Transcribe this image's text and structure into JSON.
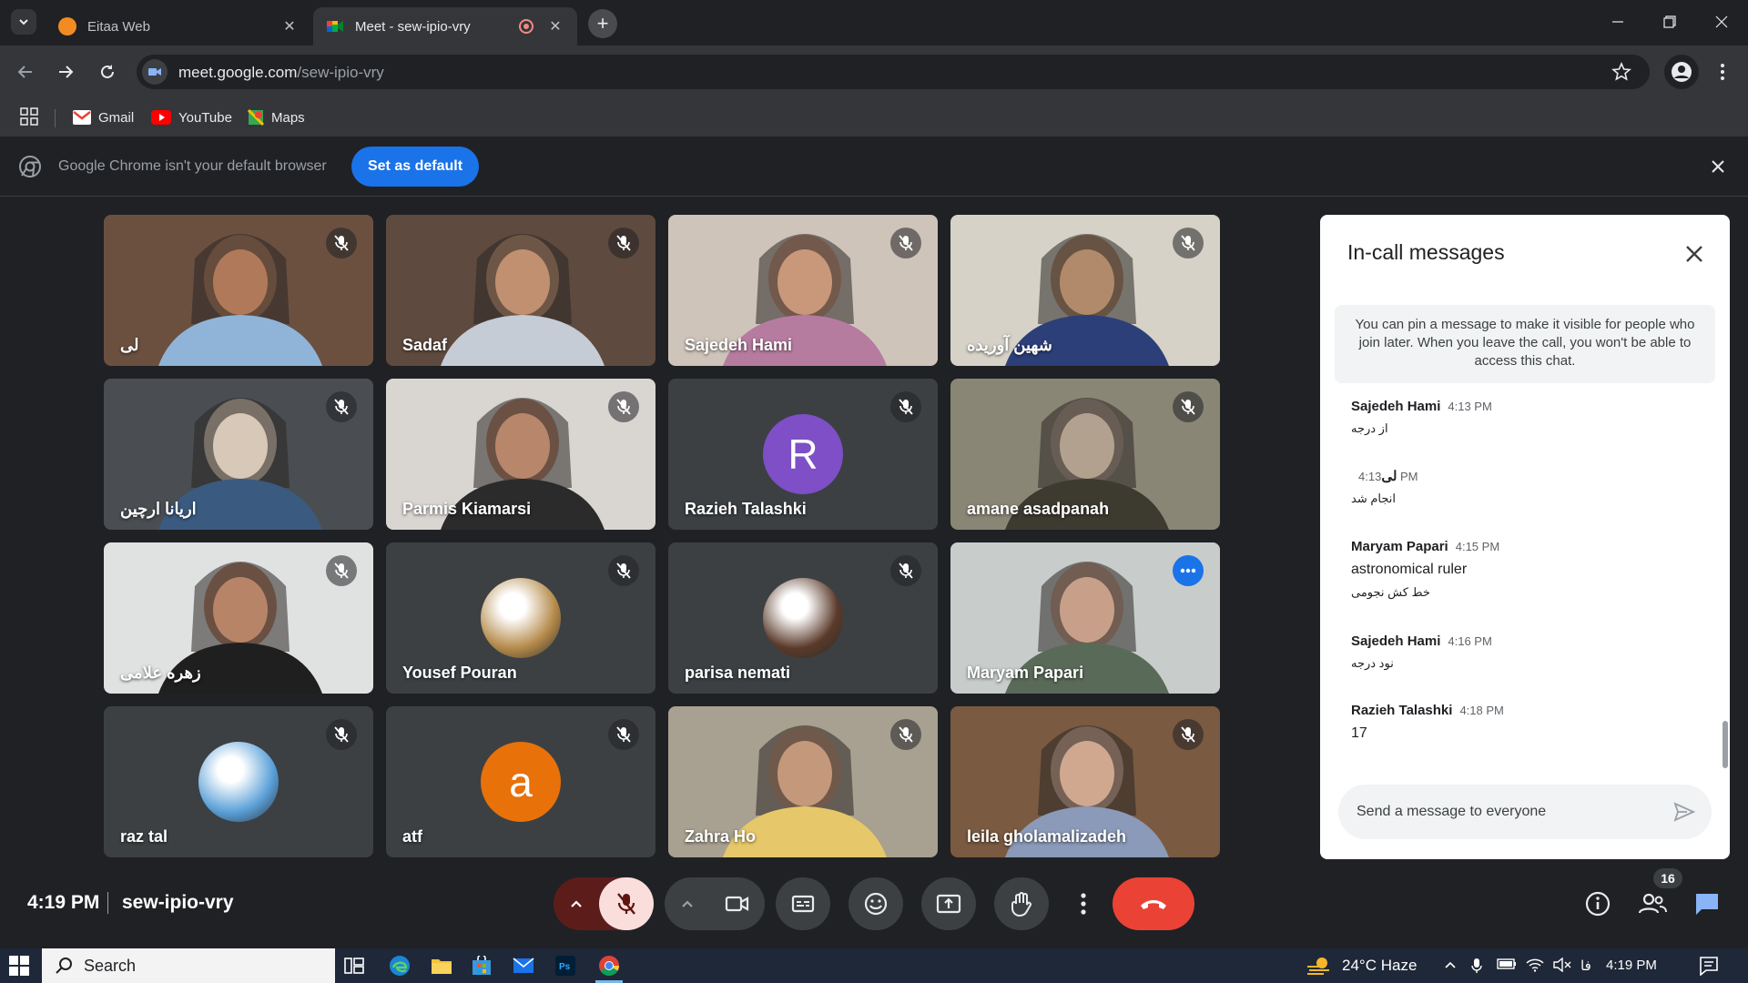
{
  "browser": {
    "tabs": [
      {
        "title": "Eitaa Web",
        "active": false
      },
      {
        "title": "Meet - sew-ipio-vry",
        "active": true
      }
    ],
    "url_host": "meet.google.com",
    "url_path": "/sew-ipio-vry",
    "bookmarks": [
      "Gmail",
      "YouTube",
      "Maps"
    ],
    "infobar": {
      "message": "Google Chrome isn't your default browser",
      "button": "Set as default"
    }
  },
  "participants": [
    {
      "name": "لی",
      "type": "video",
      "bg": "#6b5040",
      "skin": "#b07a5a",
      "cloth": "#8fb4d8"
    },
    {
      "name": "Sadaf",
      "type": "video",
      "bg": "#5e4a3e",
      "skin": "#c09070",
      "cloth": "#c6ccd6"
    },
    {
      "name": "Sajedeh Hami",
      "type": "video",
      "bg": "#cfc4ba",
      "skin": "#c9987a",
      "cloth": "#b67ca0"
    },
    {
      "name": "شهین آوریده",
      "type": "video",
      "bg": "#d6d2c8",
      "skin": "#b08a6a",
      "cloth": "#2c3f78"
    },
    {
      "name": "اریانا ارچین",
      "type": "video",
      "bg": "#4a4e52",
      "skin": "#d8c8b8",
      "cloth": "#3a5a80"
    },
    {
      "name": "Parmis Kiamarsi",
      "type": "video",
      "bg": "#d9d6d2",
      "skin": "#b8866a",
      "cloth": "#2b2b2b"
    },
    {
      "name": "Razieh Talashki",
      "type": "letter",
      "letter": "R",
      "color": "#7e4fc7"
    },
    {
      "name": "amane asadpanah",
      "type": "video",
      "bg": "#8a8676",
      "skin": "#b2a18e",
      "cloth": "#3d3a30"
    },
    {
      "name": "زهره علامی",
      "type": "video",
      "bg": "#e0e2e2",
      "skin": "#b88468",
      "cloth": "#1f1f1f"
    },
    {
      "name": "Yousef Pouran",
      "type": "image-avatar",
      "color": "#b58a4a"
    },
    {
      "name": "parisa nemati",
      "type": "image-avatar",
      "color": "#5a3a2a"
    },
    {
      "name": "Maryam Papari",
      "type": "video",
      "bg": "#c8cccb",
      "skin": "#c8a08a",
      "cloth": "#5a6a58",
      "pinned": true
    },
    {
      "name": "raz tal",
      "type": "image-avatar",
      "color": "#5aa0d8"
    },
    {
      "name": "atf",
      "type": "letter",
      "letter": "a",
      "color": "#e8710a"
    },
    {
      "name": "Zahra Ho",
      "type": "video",
      "bg": "#a8a090",
      "skin": "#c4987a",
      "cloth": "#e6c86a"
    },
    {
      "name": "leila gholamalizadeh",
      "type": "video",
      "bg": "#7a5a40",
      "skin": "#d0a890",
      "cloth": "#8a9ab8"
    }
  ],
  "chat": {
    "title": "In-call messages",
    "note": "You can pin a message to make it visible for people who join later. When you leave the call, you won't be able to access this chat.",
    "messages": [
      {
        "sender": "Sajedeh Hami",
        "time": "4:13 PM",
        "lines": [
          "از درجه"
        ],
        "rtl": [
          true
        ]
      },
      {
        "sender": "لی",
        "time": "4:13 PM",
        "lines": [
          "انجام شد"
        ],
        "rtl": [
          true
        ]
      },
      {
        "sender": "Maryam Papari",
        "time": "4:15 PM",
        "lines": [
          "astronomical ruler",
          "خط کش نجومی"
        ],
        "rtl": [
          false,
          true
        ]
      },
      {
        "sender": "Sajedeh Hami",
        "time": "4:16 PM",
        "lines": [
          "نود درجه"
        ],
        "rtl": [
          true
        ]
      },
      {
        "sender": "Razieh Talashki",
        "time": "4:18 PM",
        "lines": [
          "17"
        ],
        "rtl": [
          false
        ]
      }
    ],
    "input_placeholder": "Send a message to everyone"
  },
  "meeting": {
    "time": "4:19 PM",
    "code": "sew-ipio-vry",
    "people_count": "16"
  },
  "taskbar": {
    "search": "Search",
    "weather": "24°C  Haze",
    "lang": "فا",
    "clock": "4:19 PM"
  }
}
